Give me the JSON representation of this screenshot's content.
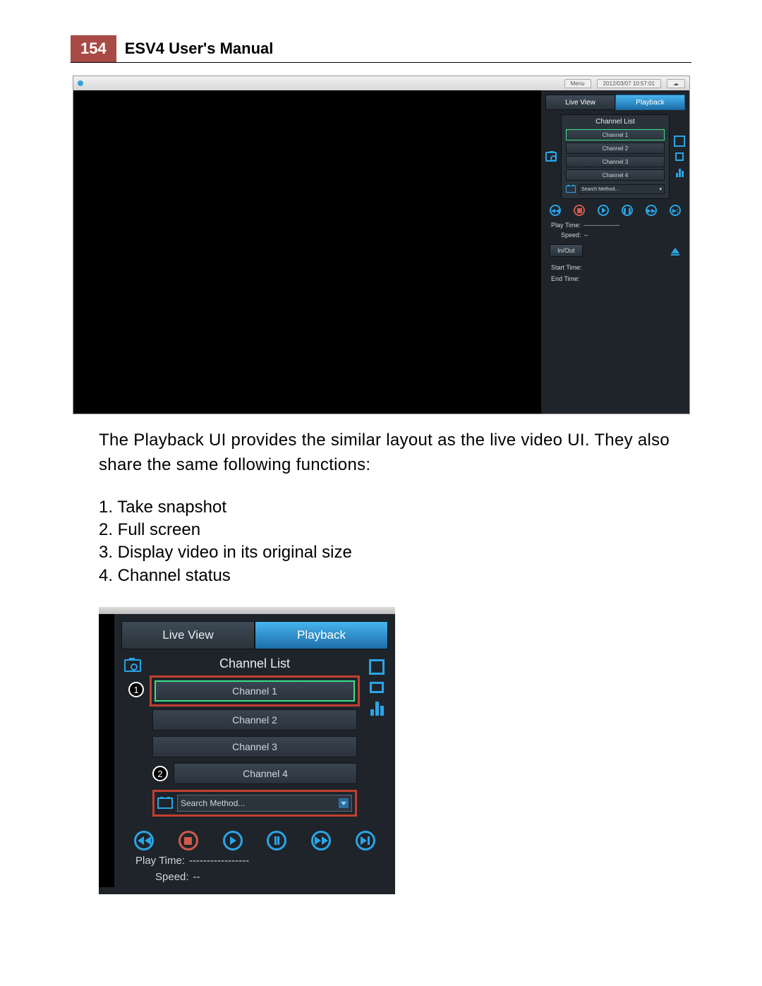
{
  "header": {
    "page_number": "154",
    "title": "ESV4 User's Manual"
  },
  "top_shot": {
    "titlebar": {
      "menu": "Menu",
      "datetime": "2012/03/07 10:57:01"
    },
    "modes": {
      "live": "Live View",
      "playback": "Playback"
    },
    "channel_list": {
      "title": "Channel List",
      "items": [
        "Channel 1",
        "Channel 2",
        "Channel 3",
        "Channel 4"
      ],
      "search": "Search Method..."
    },
    "info": {
      "play_time_label": "Play Time:",
      "play_time_value": "-----------------",
      "speed_label": "Speed:",
      "speed_value": "--",
      "inout": "In/Out",
      "start": "Start Time:",
      "end": "End Time:"
    }
  },
  "paragraph": "The Playback UI provides the similar layout as the live video UI. They also share the same following functions:",
  "list": {
    "i1": "1. Take snapshot",
    "i2": "2. Full screen",
    "i3": "3. Display video in its original size",
    "i4": "4. Channel status"
  },
  "btm_shot": {
    "modes": {
      "live": "Live View",
      "playback": "Playback"
    },
    "channel_list": {
      "title": "Channel List",
      "items": [
        "Channel 1",
        "Channel 2",
        "Channel 3",
        "Channel 4"
      ],
      "search": "Search Method..."
    },
    "callouts": {
      "c1": "1",
      "c2": "2"
    },
    "info": {
      "play_time_label": "Play Time:",
      "play_time_value": "-----------------",
      "speed_label": "Speed:",
      "speed_value": "--"
    }
  }
}
